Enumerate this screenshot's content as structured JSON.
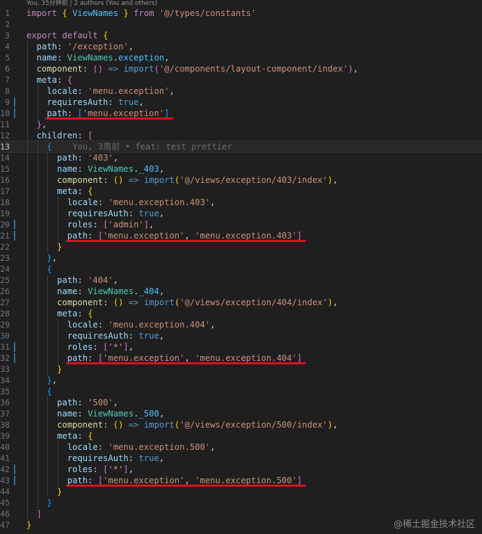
{
  "codelens": "You, 35分钟前 | 2 authors (You and others)",
  "blame": "You, 3周前 • feat: test prettier",
  "watermark": "@稀土掘金技术社区",
  "colors": {
    "background": "#1f1f1f",
    "keyword": "#c586c0",
    "string": "#ce9178",
    "property": "#9cdcfe",
    "type": "#4ec9b0",
    "boolean": "#569cd6",
    "underline": "#e0101c"
  },
  "active_line": 13,
  "lines": [
    {
      "n": "1",
      "indent": 0,
      "tokens": [
        [
          "kw",
          "import"
        ],
        [
          "plain",
          " "
        ],
        [
          "brace",
          "{"
        ],
        [
          "plain",
          " "
        ],
        [
          "prop2",
          "ViewNames"
        ],
        [
          "plain",
          " "
        ],
        [
          "brace",
          "}"
        ],
        [
          "plain",
          " "
        ],
        [
          "kw",
          "from"
        ],
        [
          "plain",
          " "
        ],
        [
          "str",
          "'@/types/constants'"
        ]
      ]
    },
    {
      "n": "2",
      "indent": 0,
      "tokens": []
    },
    {
      "n": "3",
      "indent": 0,
      "tokens": [
        [
          "kw",
          "export"
        ],
        [
          "plain",
          " "
        ],
        [
          "kw",
          "default"
        ],
        [
          "plain",
          " "
        ],
        [
          "brace",
          "{"
        ]
      ]
    },
    {
      "n": "4",
      "indent": 1,
      "tokens": [
        [
          "prop",
          "path"
        ],
        [
          "plain",
          ": "
        ],
        [
          "str",
          "'/exception'"
        ],
        [
          "plain",
          ","
        ]
      ]
    },
    {
      "n": "5",
      "indent": 1,
      "tokens": [
        [
          "prop",
          "name"
        ],
        [
          "plain",
          ": "
        ],
        [
          "id",
          "ViewNames"
        ],
        [
          "plain",
          "."
        ],
        [
          "prop2",
          "exception"
        ],
        [
          "plain",
          ","
        ]
      ]
    },
    {
      "n": "6",
      "indent": 1,
      "tokens": [
        [
          "fn",
          "component"
        ],
        [
          "plain",
          ": "
        ],
        [
          "brace2",
          "()"
        ],
        [
          "plain",
          " "
        ],
        [
          "op",
          "=>"
        ],
        [
          "plain",
          " "
        ],
        [
          "import",
          "import"
        ],
        [
          "brace2",
          "("
        ],
        [
          "str",
          "'@/components/layout-component/index'"
        ],
        [
          "brace2",
          ")"
        ],
        [
          "plain",
          ","
        ]
      ]
    },
    {
      "n": "7",
      "indent": 1,
      "tokens": [
        [
          "prop",
          "meta"
        ],
        [
          "plain",
          ": "
        ],
        [
          "brace2",
          "{"
        ]
      ]
    },
    {
      "n": "8",
      "indent": 2,
      "tokens": [
        [
          "prop",
          "locale"
        ],
        [
          "plain",
          ": "
        ],
        [
          "str",
          "'menu.exception'"
        ],
        [
          "plain",
          ","
        ]
      ]
    },
    {
      "n": "9",
      "indent": 2,
      "bar": true,
      "tokens": [
        [
          "prop",
          "requiresAuth"
        ],
        [
          "plain",
          ": "
        ],
        [
          "bool",
          "true"
        ],
        [
          "plain",
          ","
        ]
      ]
    },
    {
      "n": "10",
      "indent": 2,
      "bar": true,
      "tokens": [
        [
          "prop",
          "path"
        ],
        [
          "plain",
          ": "
        ],
        [
          "brace3",
          "["
        ],
        [
          "str",
          "'menu.exception'"
        ],
        [
          "brace3",
          "]"
        ]
      ]
    },
    {
      "n": "11",
      "indent": 1,
      "tokens": [
        [
          "brace2",
          "}"
        ],
        [
          "plain",
          ","
        ]
      ]
    },
    {
      "n": "12",
      "indent": 1,
      "tokens": [
        [
          "prop",
          "children"
        ],
        [
          "plain",
          ": "
        ],
        [
          "brace2",
          "["
        ]
      ]
    },
    {
      "n": "13",
      "indent": 2,
      "tokens": [
        [
          "brace3",
          "{"
        ]
      ],
      "blame": true
    },
    {
      "n": "14",
      "indent": 3,
      "tokens": [
        [
          "prop",
          "path"
        ],
        [
          "plain",
          ": "
        ],
        [
          "str",
          "'403'"
        ],
        [
          "plain",
          ","
        ]
      ]
    },
    {
      "n": "15",
      "indent": 3,
      "tokens": [
        [
          "prop",
          "name"
        ],
        [
          "plain",
          ": "
        ],
        [
          "id",
          "ViewNames"
        ],
        [
          "plain",
          "."
        ],
        [
          "prop2",
          "_403"
        ],
        [
          "plain",
          ","
        ]
      ]
    },
    {
      "n": "16",
      "indent": 3,
      "tokens": [
        [
          "fn",
          "component"
        ],
        [
          "plain",
          ": "
        ],
        [
          "brace",
          "()"
        ],
        [
          "plain",
          " "
        ],
        [
          "op",
          "=>"
        ],
        [
          "plain",
          " "
        ],
        [
          "import",
          "import"
        ],
        [
          "brace",
          "("
        ],
        [
          "str",
          "'@/views/exception/403/index'"
        ],
        [
          "brace",
          ")"
        ],
        [
          "plain",
          ","
        ]
      ]
    },
    {
      "n": "17",
      "indent": 3,
      "tokens": [
        [
          "prop",
          "meta"
        ],
        [
          "plain",
          ": "
        ],
        [
          "brace",
          "{"
        ]
      ]
    },
    {
      "n": "18",
      "indent": 4,
      "tokens": [
        [
          "prop",
          "locale"
        ],
        [
          "plain",
          ": "
        ],
        [
          "str",
          "'menu.exception.403'"
        ],
        [
          "plain",
          ","
        ]
      ]
    },
    {
      "n": "19",
      "indent": 4,
      "tokens": [
        [
          "prop",
          "requiresAuth"
        ],
        [
          "plain",
          ": "
        ],
        [
          "bool",
          "true"
        ],
        [
          "plain",
          ","
        ]
      ]
    },
    {
      "n": "20",
      "indent": 4,
      "bar": true,
      "tokens": [
        [
          "prop",
          "roles"
        ],
        [
          "plain",
          ": "
        ],
        [
          "brace2",
          "["
        ],
        [
          "str",
          "'admin'"
        ],
        [
          "brace2",
          "]"
        ],
        [
          "plain",
          ","
        ]
      ]
    },
    {
      "n": "21",
      "indent": 4,
      "bar": true,
      "tokens": [
        [
          "prop",
          "path"
        ],
        [
          "plain",
          ": "
        ],
        [
          "brace2",
          "["
        ],
        [
          "str",
          "'menu.exception'"
        ],
        [
          "plain",
          ", "
        ],
        [
          "str",
          "'menu.exception.403'"
        ],
        [
          "brace2",
          "]"
        ]
      ]
    },
    {
      "n": "22",
      "indent": 3,
      "tokens": [
        [
          "brace",
          "}"
        ]
      ]
    },
    {
      "n": "23",
      "indent": 2,
      "tokens": [
        [
          "brace3",
          "}"
        ],
        [
          "plain",
          ","
        ]
      ]
    },
    {
      "n": "24",
      "indent": 2,
      "tokens": [
        [
          "brace3",
          "{"
        ]
      ]
    },
    {
      "n": "25",
      "indent": 3,
      "tokens": [
        [
          "prop",
          "path"
        ],
        [
          "plain",
          ": "
        ],
        [
          "str",
          "'404'"
        ],
        [
          "plain",
          ","
        ]
      ]
    },
    {
      "n": "26",
      "indent": 3,
      "tokens": [
        [
          "prop",
          "name"
        ],
        [
          "plain",
          ": "
        ],
        [
          "id",
          "ViewNames"
        ],
        [
          "plain",
          "."
        ],
        [
          "prop2",
          "_404"
        ],
        [
          "plain",
          ","
        ]
      ]
    },
    {
      "n": "27",
      "indent": 3,
      "tokens": [
        [
          "fn",
          "component"
        ],
        [
          "plain",
          ": "
        ],
        [
          "brace",
          "()"
        ],
        [
          "plain",
          " "
        ],
        [
          "op",
          "=>"
        ],
        [
          "plain",
          " "
        ],
        [
          "import",
          "import"
        ],
        [
          "brace",
          "("
        ],
        [
          "str",
          "'@/views/exception/404/index'"
        ],
        [
          "brace",
          ")"
        ],
        [
          "plain",
          ","
        ]
      ]
    },
    {
      "n": "28",
      "indent": 3,
      "tokens": [
        [
          "prop",
          "meta"
        ],
        [
          "plain",
          ": "
        ],
        [
          "brace",
          "{"
        ]
      ]
    },
    {
      "n": "29",
      "indent": 4,
      "tokens": [
        [
          "prop",
          "locale"
        ],
        [
          "plain",
          ": "
        ],
        [
          "str",
          "'menu.exception.404'"
        ],
        [
          "plain",
          ","
        ]
      ]
    },
    {
      "n": "30",
      "indent": 4,
      "tokens": [
        [
          "prop",
          "requiresAuth"
        ],
        [
          "plain",
          ": "
        ],
        [
          "bool",
          "true"
        ],
        [
          "plain",
          ","
        ]
      ]
    },
    {
      "n": "31",
      "indent": 4,
      "bar": true,
      "tokens": [
        [
          "prop",
          "roles"
        ],
        [
          "plain",
          ": "
        ],
        [
          "brace2",
          "["
        ],
        [
          "str",
          "'*'"
        ],
        [
          "brace2",
          "]"
        ],
        [
          "plain",
          ","
        ]
      ]
    },
    {
      "n": "32",
      "indent": 4,
      "bar": true,
      "tokens": [
        [
          "prop",
          "path"
        ],
        [
          "plain",
          ": "
        ],
        [
          "brace2",
          "["
        ],
        [
          "str",
          "'menu.exception'"
        ],
        [
          "plain",
          ", "
        ],
        [
          "str",
          "'menu.exception.404'"
        ],
        [
          "brace2",
          "]"
        ]
      ]
    },
    {
      "n": "33",
      "indent": 3,
      "tokens": [
        [
          "brace",
          "}"
        ]
      ]
    },
    {
      "n": "34",
      "indent": 2,
      "tokens": [
        [
          "brace3",
          "}"
        ],
        [
          "plain",
          ","
        ]
      ]
    },
    {
      "n": "35",
      "indent": 2,
      "tokens": [
        [
          "brace3",
          "{"
        ]
      ]
    },
    {
      "n": "36",
      "indent": 3,
      "tokens": [
        [
          "prop",
          "path"
        ],
        [
          "plain",
          ": "
        ],
        [
          "str",
          "'500'"
        ],
        [
          "plain",
          ","
        ]
      ]
    },
    {
      "n": "37",
      "indent": 3,
      "tokens": [
        [
          "prop",
          "name"
        ],
        [
          "plain",
          ": "
        ],
        [
          "id",
          "ViewNames"
        ],
        [
          "plain",
          "."
        ],
        [
          "prop2",
          "_500"
        ],
        [
          "plain",
          ","
        ]
      ]
    },
    {
      "n": "38",
      "indent": 3,
      "tokens": [
        [
          "fn",
          "component"
        ],
        [
          "plain",
          ": "
        ],
        [
          "brace",
          "()"
        ],
        [
          "plain",
          " "
        ],
        [
          "op",
          "=>"
        ],
        [
          "plain",
          " "
        ],
        [
          "import",
          "import"
        ],
        [
          "brace",
          "("
        ],
        [
          "str",
          "'@/views/exception/500/index'"
        ],
        [
          "brace",
          ")"
        ],
        [
          "plain",
          ","
        ]
      ]
    },
    {
      "n": "39",
      "indent": 3,
      "tokens": [
        [
          "prop",
          "meta"
        ],
        [
          "plain",
          ": "
        ],
        [
          "brace",
          "{"
        ]
      ]
    },
    {
      "n": "40",
      "indent": 4,
      "tokens": [
        [
          "prop",
          "locale"
        ],
        [
          "plain",
          ": "
        ],
        [
          "str",
          "'menu.exception.500'"
        ],
        [
          "plain",
          ","
        ]
      ]
    },
    {
      "n": "41",
      "indent": 4,
      "tokens": [
        [
          "prop",
          "requiresAuth"
        ],
        [
          "plain",
          ": "
        ],
        [
          "bool",
          "true"
        ],
        [
          "plain",
          ","
        ]
      ]
    },
    {
      "n": "42",
      "indent": 4,
      "bar": true,
      "tokens": [
        [
          "prop",
          "roles"
        ],
        [
          "plain",
          ": "
        ],
        [
          "brace2",
          "["
        ],
        [
          "str",
          "'*'"
        ],
        [
          "brace2",
          "]"
        ],
        [
          "plain",
          ","
        ]
      ]
    },
    {
      "n": "43",
      "indent": 4,
      "bar": true,
      "tokens": [
        [
          "prop",
          "path"
        ],
        [
          "plain",
          ": "
        ],
        [
          "brace2",
          "["
        ],
        [
          "str",
          "'menu.exception'"
        ],
        [
          "plain",
          ", "
        ],
        [
          "str",
          "'menu.exception.500'"
        ],
        [
          "brace2",
          "]"
        ]
      ]
    },
    {
      "n": "44",
      "indent": 3,
      "tokens": [
        [
          "brace",
          "}"
        ]
      ]
    },
    {
      "n": "45",
      "indent": 2,
      "tokens": [
        [
          "brace3",
          "}"
        ]
      ]
    },
    {
      "n": "46",
      "indent": 1,
      "tokens": [
        [
          "brace2",
          "]"
        ]
      ]
    },
    {
      "n": "47",
      "indent": 0,
      "tokens": [
        [
          "brace",
          "}"
        ]
      ]
    }
  ]
}
